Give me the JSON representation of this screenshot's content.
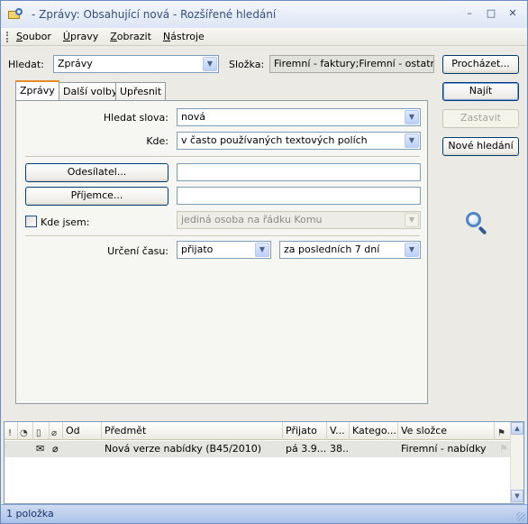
{
  "window": {
    "title": "- Zprávy: Obsahující nová - Rozšířené hledání",
    "buttons": {
      "minimize": "–",
      "maximize": "□",
      "close": "✕"
    }
  },
  "menu": [
    "Soubor",
    "Úpravy",
    "Zobrazit",
    "Nástroje"
  ],
  "search": {
    "hledat_label": "Hledat:",
    "hledat_value": "Zprávy",
    "slozka_label": "Složka:",
    "slozka_value": "Firemní - faktury;Firemní - ostatní;Fir",
    "prochazet": "Procházet..."
  },
  "actions": {
    "najit": "Najít",
    "zastavit": "Zastavit",
    "nove_hledani": "Nové hledání"
  },
  "tabs": [
    "Zprávy",
    "Další volby",
    "Upřesnit"
  ],
  "form": {
    "hledat_slova_label": "Hledat slova:",
    "hledat_slova_value": "nová",
    "kde_label": "Kde:",
    "kde_value": "v často používaných textových polích",
    "odesilatel": "Odesílatel...",
    "prijemce": "Příjemce...",
    "kde_jsem_label": "Kde jsem:",
    "kde_jsem_value": "jediná osoba na řádku Komu",
    "urceni_casu_label": "Určení času:",
    "cas_typ": "přijato",
    "cas_obdobi": "za posledních 7 dní"
  },
  "results": {
    "columns": [
      "Od",
      "Předmět",
      "Přijato",
      "V...",
      "Katego...",
      "Ve složce"
    ],
    "rows": [
      {
        "od": "",
        "predmet": "Nová verze nabídky (B45/2010)",
        "prijato": "pá 3.9....",
        "velikost": "38...",
        "kategorie": "",
        "slozka": "Firemní - nabídky"
      }
    ]
  },
  "status": {
    "count": "1 položka"
  }
}
